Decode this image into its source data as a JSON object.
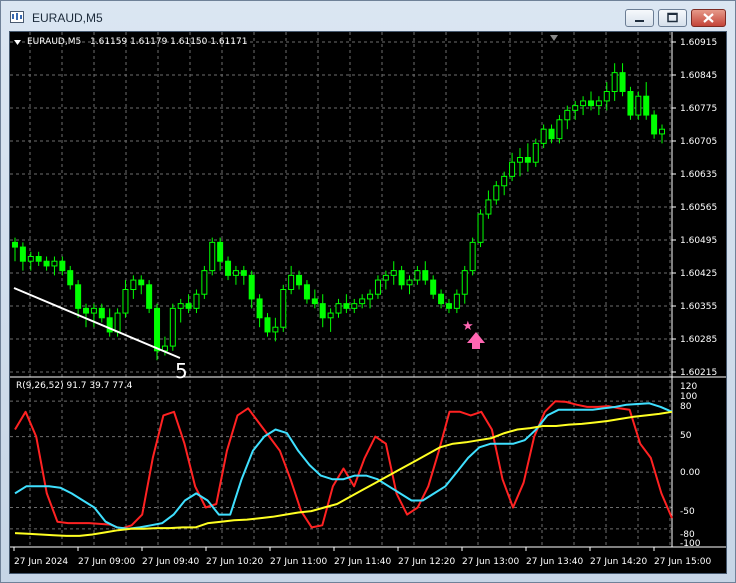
{
  "window": {
    "title": "EURAUD,M5"
  },
  "chart": {
    "header_symbol": "EURAUD,M5",
    "header_ohlc": "1.61159 1.61179 1.61150 1.61171",
    "wave_label": "5",
    "price_labels": [
      "1.60915",
      "1.60845",
      "1.60775",
      "1.60705",
      "1.60635",
      "1.60565",
      "1.60495",
      "1.60425",
      "1.60355",
      "1.60285",
      "1.60215"
    ],
    "indicator_header": "R(9,26,52) 91.7 39.7 77.4",
    "indicator_labels": [
      "120",
      "100",
      "80",
      "50",
      "0.00",
      "-50",
      "-80",
      "-100"
    ],
    "time_labels": [
      "27 Jun 2024",
      "27 Jun 09:00",
      "27 Jun 09:40",
      "27 Jun 10:20",
      "27 Jun 11:00",
      "27 Jun 11:40",
      "27 Jun 12:20",
      "27 Jun 13:00",
      "27 Jun 13:40",
      "27 Jun 14:20",
      "27 Jun 15:00"
    ],
    "colors": {
      "background": "#000000",
      "grid": "#6e6e6e",
      "candle": "#00ff00",
      "line_fast": "#ff2222",
      "line_mid": "#3fe0ff",
      "line_slow": "#ffff22",
      "arrow": "#ff66b2",
      "trendline": "#ffffff"
    }
  },
  "chart_data": {
    "type": "candlestick",
    "price_ylim": [
      1.60215,
      1.60915
    ],
    "candles": [
      [
        1.6049,
        1.605,
        1.6045,
        1.6048
      ],
      [
        1.6048,
        1.6049,
        1.6043,
        1.6045
      ],
      [
        1.6045,
        1.6047,
        1.6043,
        1.6046
      ],
      [
        1.6046,
        1.6047,
        1.6044,
        1.6045
      ],
      [
        1.6045,
        1.6046,
        1.6043,
        1.6044
      ],
      [
        1.6044,
        1.6046,
        1.6042,
        1.6045
      ],
      [
        1.6045,
        1.6046,
        1.6042,
        1.6043
      ],
      [
        1.6043,
        1.6044,
        1.6039,
        1.604
      ],
      [
        1.604,
        1.6041,
        1.6033,
        1.6035
      ],
      [
        1.6035,
        1.6036,
        1.6031,
        1.6034
      ],
      [
        1.6034,
        1.6036,
        1.6031,
        1.6035
      ],
      [
        1.6035,
        1.6036,
        1.6032,
        1.6033
      ],
      [
        1.6033,
        1.6035,
        1.6029,
        1.603
      ],
      [
        1.603,
        1.6035,
        1.6029,
        1.6034
      ],
      [
        1.6034,
        1.6041,
        1.6033,
        1.6039
      ],
      [
        1.6039,
        1.6042,
        1.6037,
        1.6041
      ],
      [
        1.6041,
        1.6042,
        1.6038,
        1.604
      ],
      [
        1.604,
        1.6041,
        1.6034,
        1.6035
      ],
      [
        1.6035,
        1.6036,
        1.6024,
        1.6026
      ],
      [
        1.6026,
        1.6029,
        1.6025,
        1.6027
      ],
      [
        1.6027,
        1.6036,
        1.6026,
        1.6035
      ],
      [
        1.6035,
        1.6037,
        1.6032,
        1.6036
      ],
      [
        1.6036,
        1.6038,
        1.6034,
        1.6035
      ],
      [
        1.6035,
        1.6039,
        1.6034,
        1.6038
      ],
      [
        1.6038,
        1.6044,
        1.6037,
        1.6043
      ],
      [
        1.6043,
        1.605,
        1.6042,
        1.6049
      ],
      [
        1.6049,
        1.605,
        1.6043,
        1.6045
      ],
      [
        1.6045,
        1.6046,
        1.6041,
        1.6042
      ],
      [
        1.6042,
        1.6044,
        1.604,
        1.6043
      ],
      [
        1.6043,
        1.6044,
        1.604,
        1.6042
      ],
      [
        1.6042,
        1.6043,
        1.6035,
        1.6037
      ],
      [
        1.6037,
        1.6038,
        1.6031,
        1.6033
      ],
      [
        1.6033,
        1.6034,
        1.6029,
        1.603
      ],
      [
        1.603,
        1.6033,
        1.6028,
        1.6031
      ],
      [
        1.6031,
        1.604,
        1.603,
        1.6039
      ],
      [
        1.6039,
        1.6044,
        1.6038,
        1.6042
      ],
      [
        1.6042,
        1.6043,
        1.6039,
        1.604
      ],
      [
        1.604,
        1.6041,
        1.6036,
        1.6037
      ],
      [
        1.6037,
        1.6039,
        1.6035,
        1.6036
      ],
      [
        1.6036,
        1.6038,
        1.6031,
        1.6033
      ],
      [
        1.6033,
        1.6035,
        1.603,
        1.6034
      ],
      [
        1.6034,
        1.6037,
        1.6033,
        1.6036
      ],
      [
        1.6036,
        1.6038,
        1.6034,
        1.6035
      ],
      [
        1.6035,
        1.6037,
        1.6034,
        1.6036
      ],
      [
        1.6036,
        1.6038,
        1.6035,
        1.6037
      ],
      [
        1.6037,
        1.6039,
        1.6035,
        1.6038
      ],
      [
        1.6038,
        1.6042,
        1.6037,
        1.6041
      ],
      [
        1.6041,
        1.6043,
        1.6039,
        1.6042
      ],
      [
        1.6042,
        1.6045,
        1.604,
        1.6043
      ],
      [
        1.6043,
        1.6044,
        1.6039,
        1.604
      ],
      [
        1.604,
        1.6042,
        1.6038,
        1.6041
      ],
      [
        1.6041,
        1.6044,
        1.604,
        1.6043
      ],
      [
        1.6043,
        1.6045,
        1.604,
        1.6041
      ],
      [
        1.6041,
        1.6042,
        1.6037,
        1.6038
      ],
      [
        1.6038,
        1.6039,
        1.6035,
        1.6036
      ],
      [
        1.6036,
        1.6037,
        1.6034,
        1.6035
      ],
      [
        1.6035,
        1.6039,
        1.6034,
        1.6038
      ],
      [
        1.6038,
        1.6044,
        1.6036,
        1.6043
      ],
      [
        1.6043,
        1.605,
        1.6042,
        1.6049
      ],
      [
        1.6049,
        1.6056,
        1.6048,
        1.6055
      ],
      [
        1.6055,
        1.606,
        1.6054,
        1.6058
      ],
      [
        1.6058,
        1.6062,
        1.6057,
        1.6061
      ],
      [
        1.6061,
        1.6064,
        1.6059,
        1.6063
      ],
      [
        1.6063,
        1.6068,
        1.6062,
        1.6066
      ],
      [
        1.6066,
        1.6069,
        1.6063,
        1.6067
      ],
      [
        1.6067,
        1.607,
        1.6064,
        1.6066
      ],
      [
        1.6066,
        1.6071,
        1.6065,
        1.607
      ],
      [
        1.607,
        1.6074,
        1.6069,
        1.6073
      ],
      [
        1.6073,
        1.6074,
        1.607,
        1.6071
      ],
      [
        1.6071,
        1.6076,
        1.607,
        1.6075
      ],
      [
        1.6075,
        1.6078,
        1.6073,
        1.6077
      ],
      [
        1.6077,
        1.6079,
        1.6075,
        1.6078
      ],
      [
        1.6078,
        1.608,
        1.6076,
        1.6079
      ],
      [
        1.6079,
        1.6081,
        1.6077,
        1.6078
      ],
      [
        1.6078,
        1.608,
        1.6076,
        1.6079
      ],
      [
        1.6079,
        1.6083,
        1.6077,
        1.6081
      ],
      [
        1.6081,
        1.6087,
        1.6079,
        1.6085
      ],
      [
        1.6085,
        1.6087,
        1.608,
        1.6081
      ],
      [
        1.6081,
        1.6082,
        1.6075,
        1.6076
      ],
      [
        1.6076,
        1.6081,
        1.6075,
        1.608
      ],
      [
        1.608,
        1.6083,
        1.6075,
        1.6076
      ],
      [
        1.6076,
        1.6077,
        1.6071,
        1.6072
      ],
      [
        1.6072,
        1.6074,
        1.607,
        1.6073
      ]
    ],
    "indicator": {
      "ylim": [
        -100,
        120
      ],
      "series": [
        {
          "values": [
            60,
            85,
            50,
            -30,
            -70,
            -72,
            -72,
            -72,
            -73,
            -74,
            -80,
            -75,
            -60,
            20,
            80,
            85,
            40,
            -20,
            -50,
            -45,
            30,
            80,
            90,
            70,
            50,
            30,
            -10,
            -55,
            -78,
            -75,
            -20,
            5,
            -20,
            20,
            50,
            40,
            -30,
            -60,
            -50,
            -20,
            30,
            85,
            85,
            80,
            85,
            60,
            -10,
            -50,
            -15,
            50,
            85,
            100,
            99,
            95,
            92,
            92,
            93,
            90,
            88,
            40,
            20,
            -30,
            -65
          ]
        },
        {
          "values": [
            -30,
            -20,
            -20,
            -20,
            -22,
            -30,
            -40,
            -50,
            -70,
            -78,
            -80,
            -78,
            -75,
            -72,
            -60,
            -40,
            -30,
            -40,
            -60,
            -60,
            -10,
            30,
            50,
            60,
            55,
            30,
            10,
            -5,
            -10,
            -10,
            -5,
            -5,
            -10,
            -20,
            -30,
            -40,
            -40,
            -30,
            -20,
            0,
            20,
            35,
            40,
            40,
            40,
            45,
            60,
            80,
            88,
            88,
            88,
            88,
            90,
            92,
            95,
            96,
            97,
            92,
            85
          ]
        },
        {
          "values": [
            -86,
            -87,
            -88,
            -89,
            -90,
            -90,
            -88,
            -85,
            -82,
            -80,
            -80,
            -79,
            -79,
            -78,
            -78,
            -72,
            -70,
            -68,
            -67,
            -65,
            -63,
            -60,
            -57,
            -55,
            -50,
            -45,
            -35,
            -25,
            -15,
            -5,
            5,
            15,
            25,
            35,
            40,
            42,
            45,
            48,
            55,
            60,
            62,
            65,
            65,
            67,
            68,
            70,
            72,
            75,
            78,
            80,
            82,
            85
          ]
        }
      ]
    }
  }
}
